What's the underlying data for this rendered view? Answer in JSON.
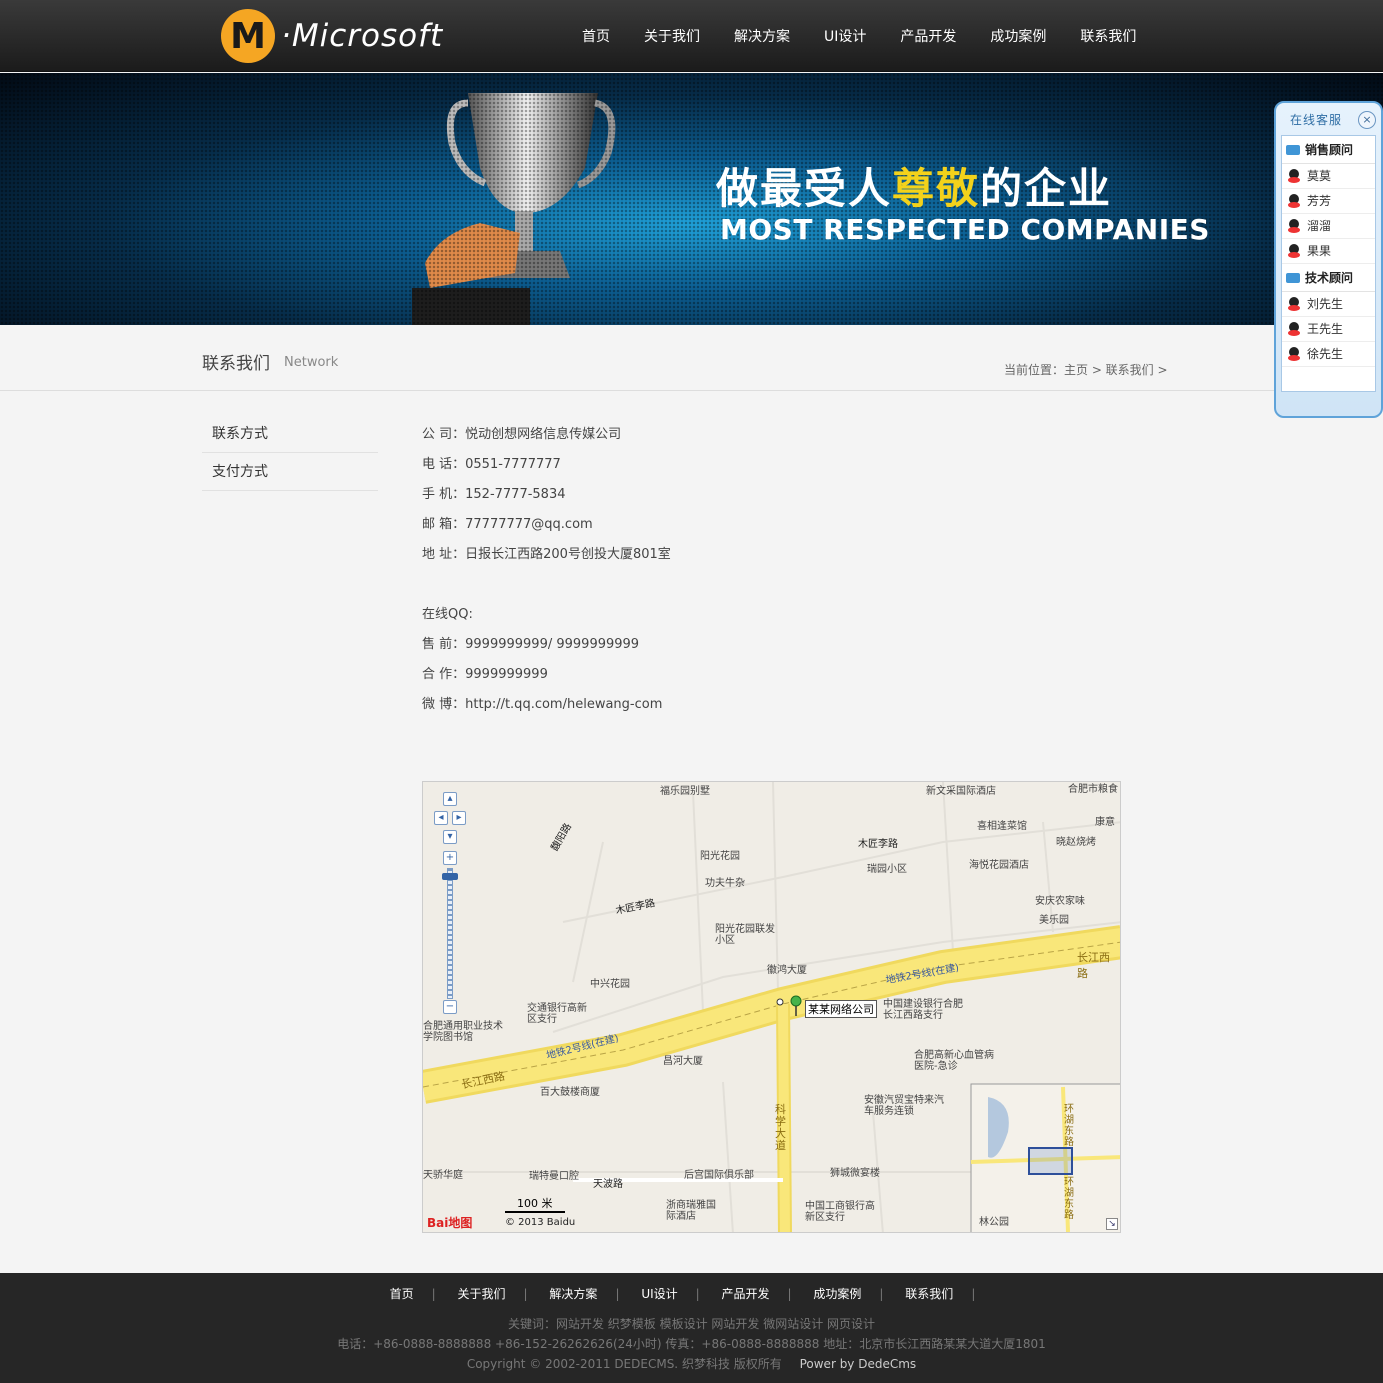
{
  "brand": {
    "logo_letter": "M",
    "name": "·Microsoft"
  },
  "nav": [
    "首页",
    "关于我们",
    "解决方案",
    "UI设计",
    "产品开发",
    "成功案例",
    "联系我们"
  ],
  "banner": {
    "cn_before": "做最受人",
    "cn_highlight": "尊敬",
    "cn_after": "的企业",
    "en": "MOST RESPECTED COMPANIES"
  },
  "page": {
    "title": "联系我们",
    "subtitle": "Network",
    "breadcrumb": "当前位置：主页 > 联系我们 >"
  },
  "sidebar": [
    "联系方式",
    "支付方式"
  ],
  "contact": {
    "company": "公 司：悦动创想网络信息传媒公司",
    "phone": "电 话：0551-7777777",
    "mobile": "手 机：152-7777-5834",
    "email": "邮 箱：77777777@qq.com",
    "address": "地 址：日报长江西路200号创投大厦801室",
    "qq_heading": "在线QQ:",
    "presale": "售 前：9999999999/ 9999999999",
    "cooperate": "合 作：9999999999",
    "weibo": "微 博：http://t.qq.com/helewang-com"
  },
  "map": {
    "marker_label": "某某网络公司",
    "scale": "100 米",
    "copyright": "© 2013 Baidu",
    "logo": "Bai地图",
    "labels": [
      "福乐园别墅",
      "新文采国际酒店",
      "合肥市粮食",
      "喜相逢菜馆",
      "康意",
      "晓赵烧烤",
      "木匠李路",
      "阳光花园",
      "瑞园小区",
      "海悦花园酒店",
      "功夫牛杂",
      "安庆农家味",
      "美乐园",
      "木匠李路",
      "阳光花园联发小区",
      "徽鸿大厦",
      "中兴花园",
      "长江西路",
      "地铁2号线(在建)",
      "交通银行高新区支行",
      "中国建设银行合肥长江西路支行",
      "合肥通用职业技术学院图书馆",
      "地铁2号线(在建)",
      "昌河大厦",
      "合肥高新心血管病医院-急诊",
      "长江西路",
      "百大鼓楼商厦",
      "安徽汽贸宝特来汽车服务连锁",
      "科学大道",
      "天骄华庭",
      "瑞特曼口腔",
      "后宫国际俱乐部",
      "狮城微宴楼",
      "天波路",
      "浙商瑞雅国际酒店",
      "中国工商银行高新区支行",
      "环湖东路",
      "环湖东路",
      "林公园",
      "馥阳路"
    ]
  },
  "service": {
    "title": "在线客服",
    "groups": [
      {
        "name": "销售顾问",
        "members": [
          "莫莫",
          "芳芳",
          "溜溜",
          "果果"
        ]
      },
      {
        "name": "技术顾问",
        "members": [
          "刘先生",
          "王先生",
          "徐先生"
        ]
      }
    ]
  },
  "footer": {
    "nav": [
      "首页",
      "关于我们",
      "解决方案",
      "UI设计",
      "产品开发",
      "成功案例",
      "联系我们"
    ],
    "keywords": "关键词：网站开发 织梦模板 模板设计 网站开发 微网站设计 网页设计",
    "contact": "电话：+86-0888-8888888 +86-152-26262626(24小时) 传真：+86-0888-8888888 地址：北京市长江西路某某大道大厦1801",
    "copyright": "Copyright © 2002-2011 DEDECMS. 织梦科技 版权所有",
    "power": "Power by DedeCms"
  },
  "colors": {
    "accent": "#f5a623",
    "header_bg": "#262626",
    "service_border": "#5fa3d9",
    "road_yellow": "#f9e77a"
  }
}
